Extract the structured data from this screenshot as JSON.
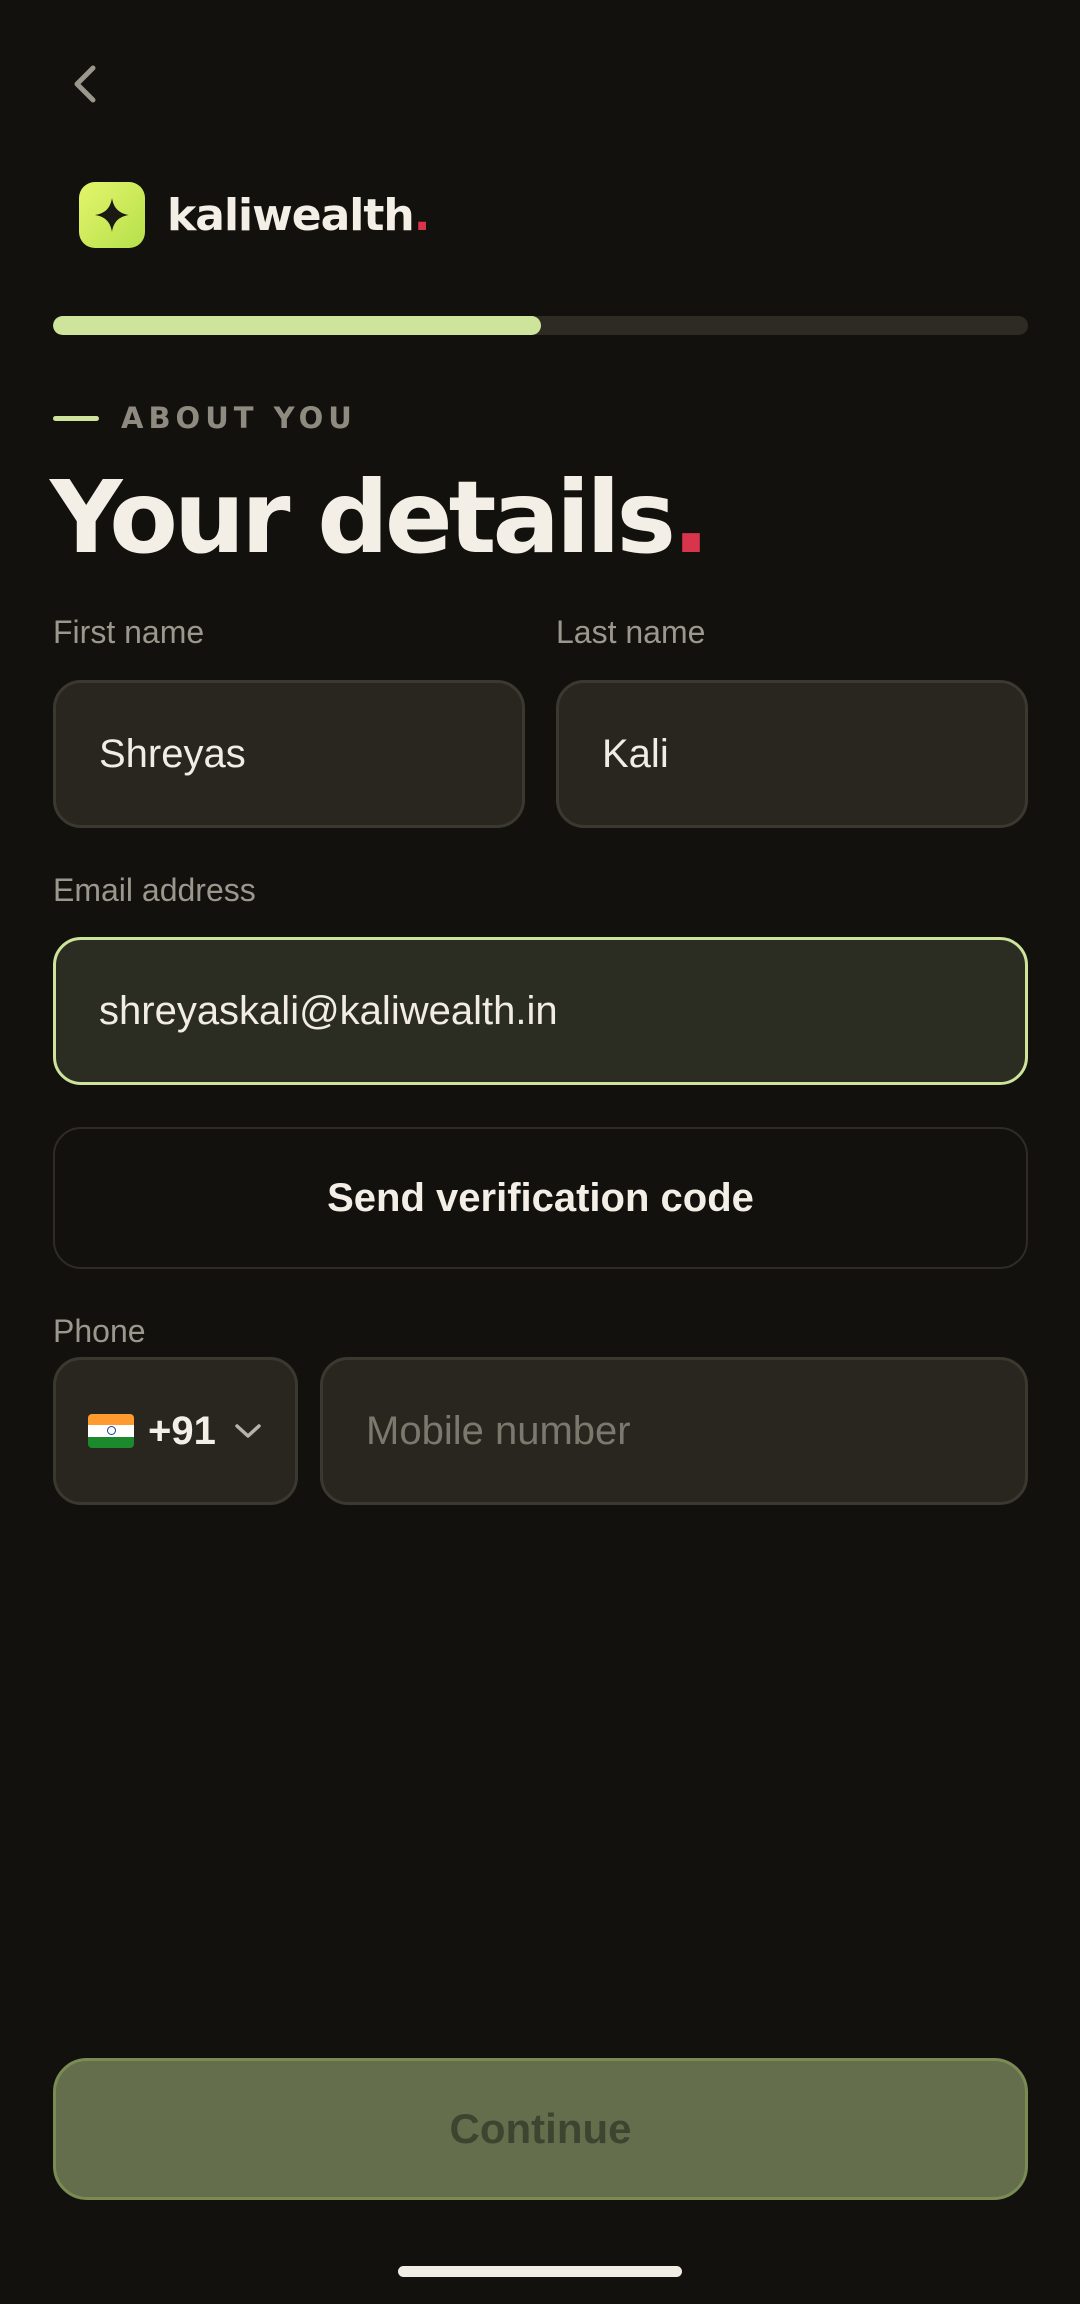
{
  "brand": {
    "name": "kaliwealth",
    "dot": "."
  },
  "progress": {
    "fraction": 0.5
  },
  "section": {
    "eyebrow": "ABOUT YOU"
  },
  "page": {
    "title": "Your details",
    "title_dot": "."
  },
  "form": {
    "first_name": {
      "label": "First name",
      "value": "Shreyas"
    },
    "last_name": {
      "label": "Last name",
      "value": "Kali"
    },
    "email": {
      "label": "Email address",
      "value": "shreyaskali@kaliwealth.in"
    },
    "verify_button": "Send verification code",
    "phone": {
      "label": "Phone",
      "country_code": "+91",
      "country_flag": "india-flag-icon",
      "placeholder": "Mobile number"
    }
  },
  "actions": {
    "continue_label": "Continue"
  },
  "icons": {
    "back": "chevron-left-icon",
    "brand": "sparkle-icon",
    "dropdown": "chevron-down-icon"
  },
  "colors": {
    "background": "#12110d",
    "accent": "#cde49a",
    "brand_dot": "#d8344c",
    "continue_disabled": "#646e4c"
  }
}
